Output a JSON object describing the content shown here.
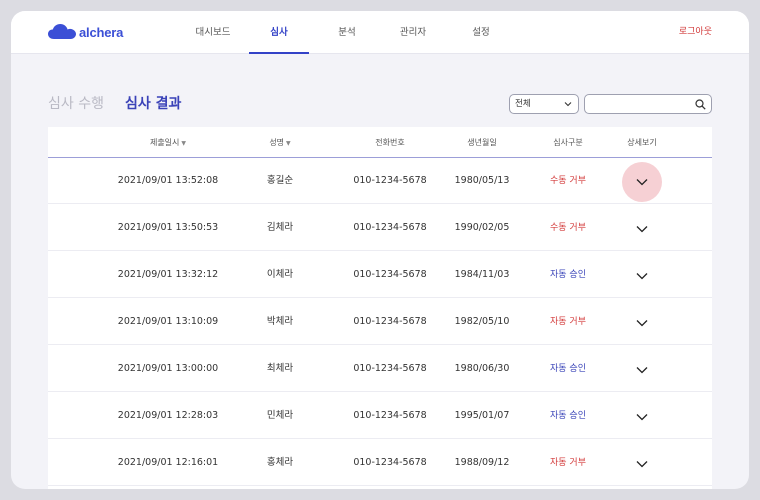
{
  "brand": {
    "name": "alchera",
    "color": "#3b4fd6"
  },
  "nav": {
    "items": [
      {
        "label": "대시보드"
      },
      {
        "label": "심사",
        "active": true
      },
      {
        "label": "분석"
      },
      {
        "label": "관리자"
      },
      {
        "label": "설정"
      }
    ],
    "logout_label": "로그아웃"
  },
  "page_tabs": [
    {
      "label": "심사 수행",
      "active": false
    },
    {
      "label": "심사 결과",
      "active": true
    }
  ],
  "filter": {
    "selected": "전체",
    "search_value": "",
    "search_icon": "search-icon"
  },
  "table": {
    "columns": [
      {
        "label": "제출일시",
        "sortable": true
      },
      {
        "label": "성명",
        "sortable": true
      },
      {
        "label": "전화번호",
        "sortable": false
      },
      {
        "label": "생년월일",
        "sortable": false
      },
      {
        "label": "심사구분",
        "sortable": false
      },
      {
        "label": "상세보기",
        "sortable": false
      }
    ],
    "sort_glyph": "▼",
    "rows": [
      {
        "submitted": "2021/09/01 13:52:08",
        "name": "홍길순",
        "phone": "010-1234-5678",
        "birth": "1980/05/13",
        "status": "수동 거부",
        "status_type": "reject",
        "highlight": true
      },
      {
        "submitted": "2021/09/01 13:50:53",
        "name": "김체라",
        "phone": "010-1234-5678",
        "birth": "1990/02/05",
        "status": "수동 거부",
        "status_type": "reject"
      },
      {
        "submitted": "2021/09/01 13:32:12",
        "name": "이체라",
        "phone": "010-1234-5678",
        "birth": "1984/11/03",
        "status": "자동 승인",
        "status_type": "approve"
      },
      {
        "submitted": "2021/09/01 13:10:09",
        "name": "박체라",
        "phone": "010-1234-5678",
        "birth": "1982/05/10",
        "status": "자동 거부",
        "status_type": "reject"
      },
      {
        "submitted": "2021/09/01 13:00:00",
        "name": "최체라",
        "phone": "010-1234-5678",
        "birth": "1980/06/30",
        "status": "자동 승인",
        "status_type": "approve"
      },
      {
        "submitted": "2021/09/01 12:28:03",
        "name": "민체라",
        "phone": "010-1234-5678",
        "birth": "1995/01/07",
        "status": "자동 승인",
        "status_type": "approve"
      },
      {
        "submitted": "2021/09/01 12:16:01",
        "name": "홍체라",
        "phone": "010-1234-5678",
        "birth": "1988/09/12",
        "status": "자동 거부",
        "status_type": "reject"
      }
    ]
  },
  "colors": {
    "accent": "#3342c7",
    "reject": "#d33b3b",
    "approve": "#3a44b8",
    "highlight": "#f6d0d4"
  }
}
